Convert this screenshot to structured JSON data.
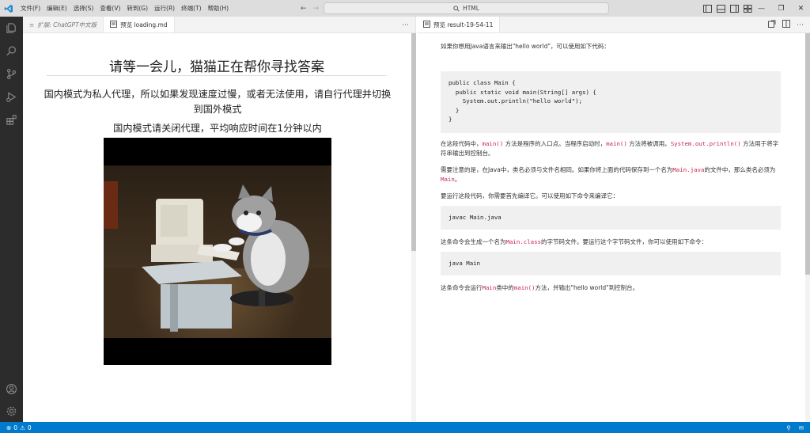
{
  "titlebar": {
    "menu": [
      "文件(F)",
      "编辑(E)",
      "选择(S)",
      "查看(V)",
      "转到(G)",
      "运行(R)",
      "终端(T)",
      "帮助(H)"
    ],
    "search_text": "HTML"
  },
  "left_group": {
    "tabs": [
      {
        "label": "扩展: ChatGPT中文版",
        "active": false,
        "italic": true,
        "icon": "extension-icon"
      },
      {
        "label": "预览 loading.md",
        "active": true,
        "italic": false,
        "icon": "preview-icon"
      }
    ],
    "heading": "请等一会儿，猫猫正在帮你寻找答案",
    "para1": "国内模式为私人代理，所以如果发现速度过慢，或者无法使用，请自行代理并切换到国外模式",
    "para2": "国内模式请关闭代理，平均响应时间在1分钟以内",
    "image_label": "cat-typing-on-computer"
  },
  "right_group": {
    "tab_label": "预览 result-19-54-11",
    "intro": "如果你想用Java语言来输出\"hello world\"，可以使用如下代码：",
    "code1": "public class Main {\n  public static void main(String[] args) {\n    System.out.println(\"hello world\");\n  }\n}",
    "p_explain": {
      "a": "在这段代码中，",
      "code_a": "main()",
      "b": " 方法是程序的入口点。当程序启动时，",
      "code_b": "main()",
      "c": " 方法将被调用。",
      "code_c": "System.out.println()",
      "d": " 方法用于将字符串输出到控制台。"
    },
    "p_note": {
      "a": "需要注意的是，在Java中，类名必须与文件名相同。如果你将上面的代码保存到一个名为",
      "code_a": "Main.java",
      "b": "的文件中，那么类名必须为",
      "code_b": "Main",
      "c": "。"
    },
    "p_compile": "要运行这段代码，你需要首先编译它。可以使用如下命令来编译它：",
    "code2": "javac Main.java",
    "p_class": {
      "a": "这条命令会生成一个名为",
      "code_a": "Main.class",
      "b": "的字节码文件。要运行这个字节码文件，你可以使用如下命令："
    },
    "code3": "java Main",
    "p_run": {
      "a": "这条命令会运行",
      "code_a": "Main",
      "b": "类中的",
      "code_b": "main()",
      "c": "方法，并输出\"hello world\"到控制台。"
    }
  },
  "statusbar": {
    "errors": "0",
    "warnings": "0"
  },
  "colors": {
    "accent": "#007acc",
    "activity_bg": "#2c2c2c",
    "inline_code": "#c7254e"
  }
}
